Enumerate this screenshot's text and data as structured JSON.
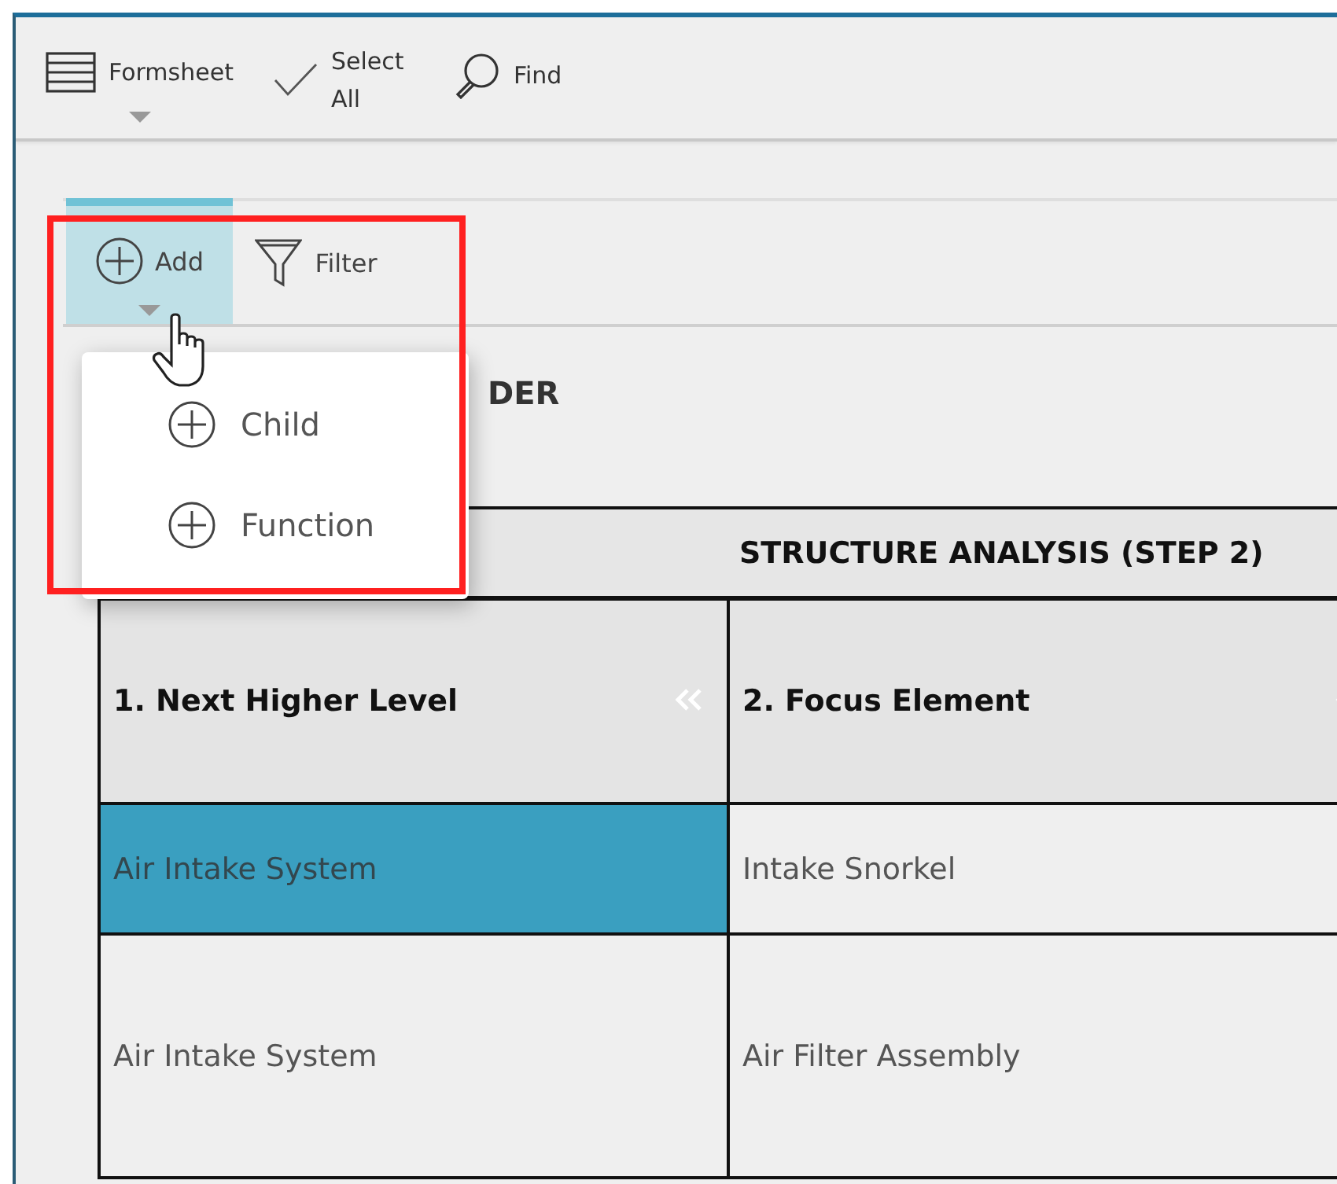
{
  "toolbar": {
    "buttons": [
      {
        "kind": "formsheet",
        "label": "Formsheet",
        "dropdown": true
      },
      {
        "kind": "select",
        "label": "Select All",
        "dropdown": false
      },
      {
        "kind": "find",
        "label": "Find",
        "dropdown": false
      }
    ]
  },
  "actions": [
    {
      "kind": "add",
      "label": "Add",
      "selected": true,
      "dropdown": true
    },
    {
      "kind": "filter",
      "label": "Filter",
      "selected": false,
      "dropdown": false
    }
  ],
  "add_menu": {
    "items": [
      {
        "label": "Child"
      },
      {
        "label": "Function"
      }
    ]
  },
  "section_title": "DER",
  "table": {
    "group_header": "STRUCTURE ANALYSIS (STEP 2)",
    "columns": [
      {
        "label": "1. Next Higher Level"
      },
      {
        "label": "2. Focus Element"
      }
    ],
    "rows": [
      {
        "cells": [
          {
            "text": "Air Intake System",
            "selected": true
          },
          {
            "text": "Intake Snorkel",
            "selected": false
          }
        ]
      },
      {
        "cells": [
          {
            "text": "Air Intake System",
            "selected": false
          },
          {
            "text": "Air Filter Assembly",
            "selected": false
          }
        ]
      }
    ]
  }
}
